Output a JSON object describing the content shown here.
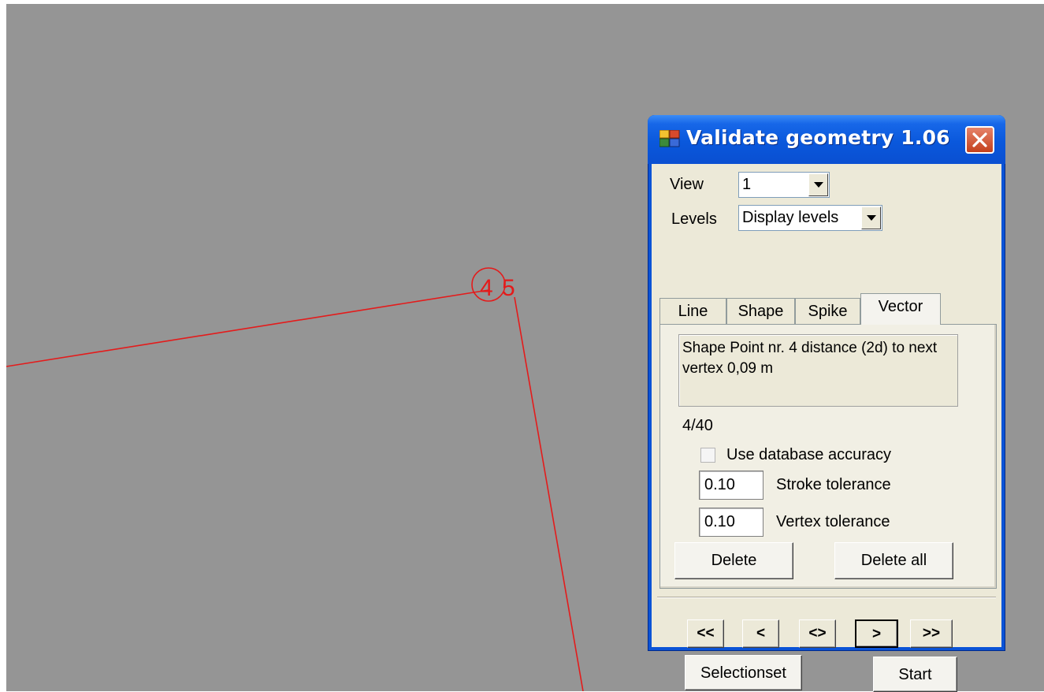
{
  "drawing": {
    "vertex_labels": [
      "4",
      "5"
    ],
    "line_color": "#e41b1b",
    "background_color": "#959595"
  },
  "window": {
    "title": "Validate geometry 1.06",
    "title_icon": "app-window-icon",
    "close_icon": "close-icon"
  },
  "view": {
    "label": "View",
    "value": "1"
  },
  "levels": {
    "label": "Levels",
    "value": "Display levels"
  },
  "tabs": [
    {
      "label": "Line"
    },
    {
      "label": "Shape"
    },
    {
      "label": "Spike"
    },
    {
      "label": "Vector",
      "active": true
    }
  ],
  "panel": {
    "message": "Shape Point nr. 4 distance (2d) to next vertex 0,09 m",
    "counter": "4/40",
    "use_db_accuracy": {
      "label": "Use database accuracy",
      "checked": false
    },
    "stroke_tolerance": {
      "value": "0.10",
      "label": "Stroke tolerance"
    },
    "vertex_tolerance": {
      "value": "0.10",
      "label": "Vertex tolerance"
    },
    "delete_label": "Delete",
    "delete_all_label": "Delete all"
  },
  "navigation": {
    "first": "<<",
    "prev": "<",
    "both": "<>",
    "next": ">",
    "last": ">>"
  },
  "footer": {
    "selectionset_label": "Selectionset",
    "start_label": "Start"
  },
  "colors": {
    "titlebar": "#0a58dc",
    "dialog_face": "#ece9d8",
    "close_button": "#c4401c"
  }
}
